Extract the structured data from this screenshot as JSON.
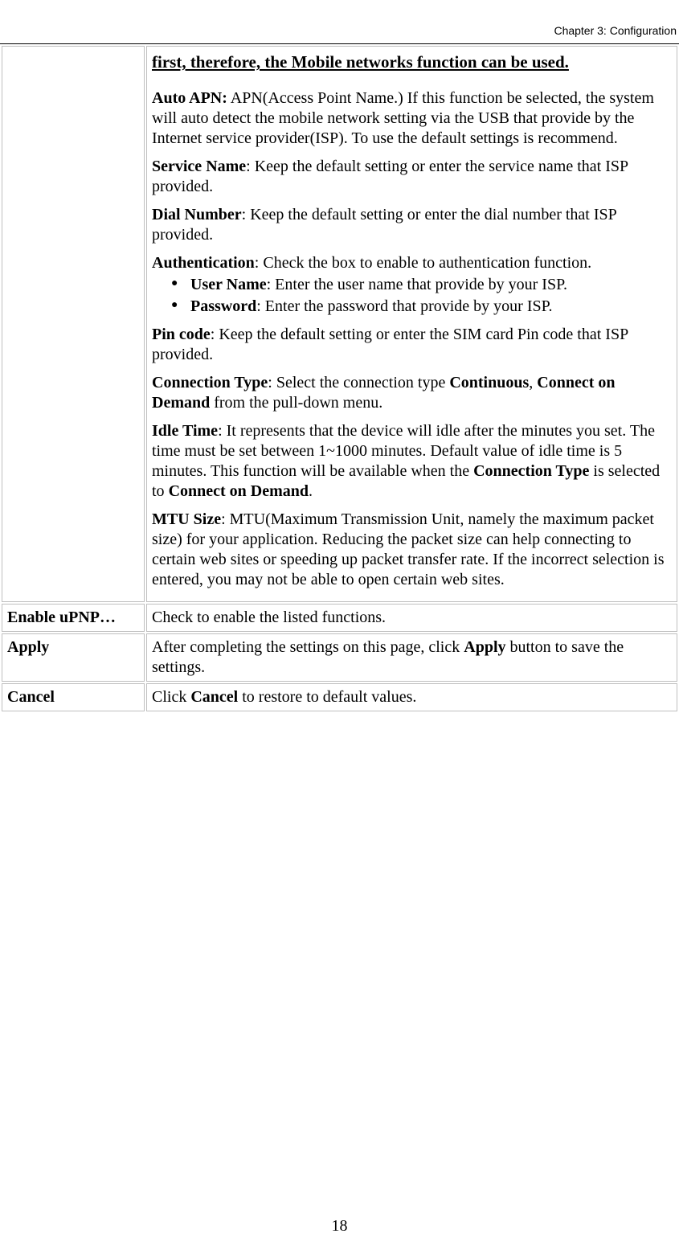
{
  "header": {
    "chapter": "Chapter 3: Configuration"
  },
  "pageNumber": "18",
  "row1": {
    "topLine": "first, therefore, the Mobile networks function can be used.",
    "autoApn": {
      "label": "Auto APN:",
      "text": " APN(Access Point Name.) If this function be selected, the system will auto detect the mobile network setting via the USB that provide by the Internet service provider(ISP). To use the default settings is recommend."
    },
    "serviceName": {
      "label": "Service Name",
      "text": ": Keep the default setting or enter the service name that ISP provided."
    },
    "dialNumber": {
      "label": "Dial Number",
      "text": ": Keep the default setting or enter the dial number that ISP provided."
    },
    "authentication": {
      "label": "Authentication",
      "text": ": Check the box to enable to authentication function."
    },
    "userName": {
      "label": "User Name",
      "text": ": Enter the user name that provide by your ISP."
    },
    "password": {
      "label": "Password",
      "text": ": Enter the password that provide by your ISP."
    },
    "pinCode": {
      "label": "Pin code",
      "text": ": Keep the default setting or enter the SIM card Pin code that ISP provided."
    },
    "connectionType": {
      "label": "Connection Type",
      "pre": ": Select the connection type ",
      "opt1": "Continuous",
      "sep": ", ",
      "opt2": "Connect on Demand",
      "post": " from the pull-down menu."
    },
    "idleTime": {
      "label": "Idle Time",
      "text1": ": It represents that the device will idle after the minutes you set. The time must be set between 1~1000 minutes. Default value of idle time is 5 minutes. This function will be available when the ",
      "label2": "Connection Type",
      "text2": " is selected to ",
      "label3": "Connect on Demand",
      "text3": "."
    },
    "mtuSize": {
      "label": "MTU Size",
      "text": ": MTU(Maximum Transmission Unit, namely the maximum packet size) for your application. Reducing the packet size can help connecting to certain web sites or speeding up packet transfer rate. If the incorrect selection is entered, you may not be able to open certain web sites."
    }
  },
  "row2": {
    "label": "Enable uPNP…",
    "text": "Check to enable the listed functions."
  },
  "row3": {
    "label": "Apply",
    "pre": "After completing the settings on this page, click ",
    "bold": "Apply",
    "post": " button to save the settings."
  },
  "row4": {
    "label": "Cancel",
    "pre": "Click ",
    "bold": "Cancel",
    "post": " to restore to default values."
  }
}
